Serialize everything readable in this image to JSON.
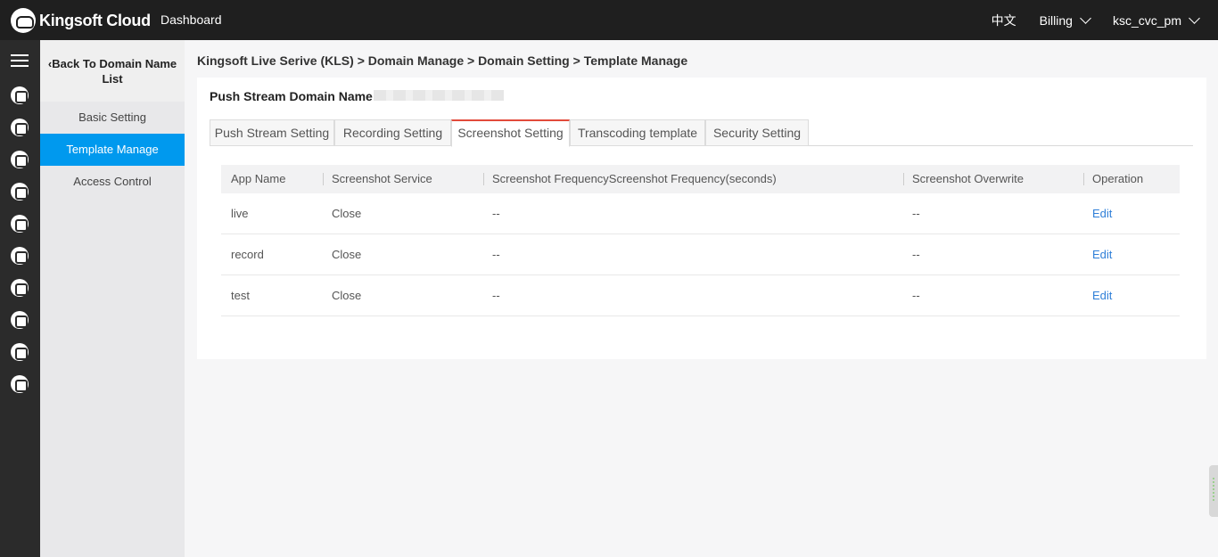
{
  "header": {
    "brand": "Kingsoft Cloud",
    "nav": "Dashboard",
    "language": "中文",
    "billing": "Billing",
    "user": "ksc_cvc_pm"
  },
  "rail": {
    "icons": [
      "menu-icon",
      "cloud-monitor-icon",
      "server-icon",
      "network-icon",
      "database-icon",
      "video-icon",
      "share-icon",
      "cdn-icon",
      "storage-icon",
      "upload-icon",
      "list-icon"
    ]
  },
  "sidebar": {
    "back_label": "Back To Domain Name List",
    "items": [
      {
        "label": "Basic Setting",
        "active": false
      },
      {
        "label": "Template Manage",
        "active": true
      },
      {
        "label": "Access Control",
        "active": false
      }
    ]
  },
  "breadcrumb": "Kingsoft Live Serive (KLS) > Domain Manage > Domain Setting > Template Manage",
  "domain": {
    "label": "Push Stream Domain Name:"
  },
  "tabs": [
    {
      "label": "Push Stream Setting",
      "active": false
    },
    {
      "label": "Recording Setting",
      "active": false
    },
    {
      "label": "Screenshot Setting",
      "active": true
    },
    {
      "label": "Transcoding template",
      "active": false
    },
    {
      "label": "Security Setting",
      "active": false
    }
  ],
  "table": {
    "headers": [
      "App Name",
      "Screenshot Service",
      "Screenshot FrequencyScreenshot Frequency(seconds)",
      "Screenshot Overwrite",
      "Operation"
    ],
    "rows": [
      {
        "app": "live",
        "service": "Close",
        "frequency": "--",
        "overwrite": "--",
        "action": "Edit"
      },
      {
        "app": "record",
        "service": "Close",
        "frequency": "--",
        "overwrite": "--",
        "action": "Edit"
      },
      {
        "app": "test",
        "service": "Close",
        "frequency": "--",
        "overwrite": "--",
        "action": "Edit"
      }
    ]
  },
  "colors": {
    "accent": "#0099ee",
    "tab_active": "#e24a3b",
    "link": "#2f7fd8",
    "topbar": "#1f1f1f"
  }
}
